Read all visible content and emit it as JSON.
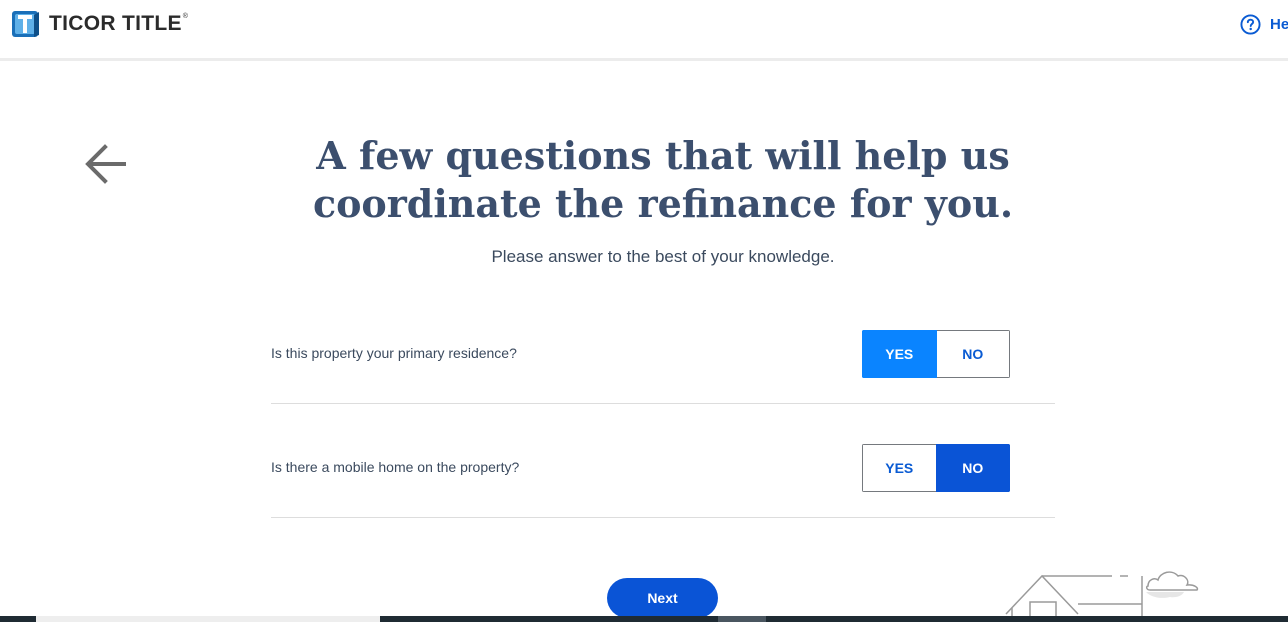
{
  "header": {
    "brand": "TICOR TITLE",
    "registered_mark": "®",
    "help_label": "Help",
    "help_icon": "question-circle-icon"
  },
  "main": {
    "back_icon": "arrow-left-icon",
    "title": "A few questions that will help us coordinate the refinance for you.",
    "subtitle": "Please answer to the best of your knowledge."
  },
  "questions": [
    {
      "text": "Is this property your primary residence?",
      "yes_label": "YES",
      "no_label": "NO",
      "selected": "YES"
    },
    {
      "text": "Is there a mobile home on the property?",
      "yes_label": "YES",
      "no_label": "NO",
      "selected": "NO"
    }
  ],
  "footer": {
    "next_label": "Next"
  },
  "colors": {
    "brand_blue": "#0a5bd3",
    "yes_selected": "#0a84ff",
    "no_selected": "#0a54d6",
    "title_text": "#3c4f6e"
  }
}
